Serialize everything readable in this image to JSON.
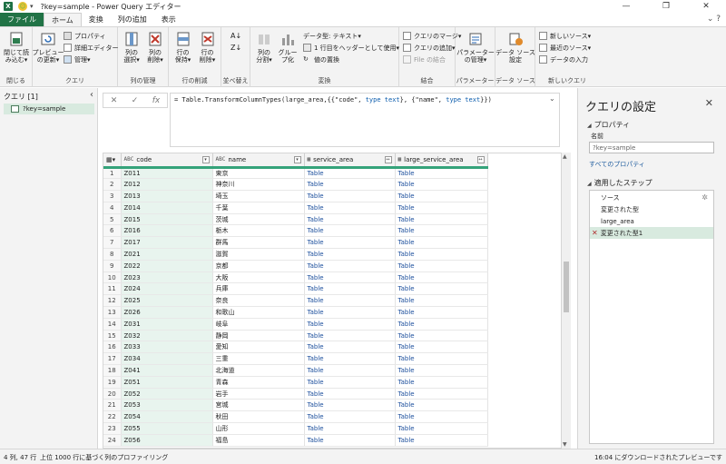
{
  "window": {
    "title": "?key=sample - Power Query エディター",
    "quick_access": "▾"
  },
  "menu_tabs": [
    "ファイル",
    "ホーム",
    "変換",
    "列の追加",
    "表示"
  ],
  "ribbon": {
    "groups": [
      {
        "label": "閉じる",
        "buttons": [
          "閉じて読\nみ込む▾"
        ]
      },
      {
        "label": "クエリ",
        "buttons": [
          "プレビュー\nの更新▾"
        ],
        "small": [
          "プロパティ",
          "詳細エディター",
          "管理▾"
        ]
      },
      {
        "label": "列の管理",
        "buttons": [
          "列の\n選択▾",
          "列の\n削除▾"
        ]
      },
      {
        "label": "行の削減",
        "buttons": [
          "行の\n保持▾",
          "行の\n削除▾"
        ]
      },
      {
        "label": "並べ替え"
      },
      {
        "label": "変換",
        "buttons": [
          "列の\n分割▾",
          "グルー\nプ化"
        ],
        "small": [
          "データ型: テキスト▾",
          "1 行目をヘッダーとして使用▾",
          "値の置換"
        ]
      },
      {
        "label": "結合",
        "small": [
          "クエリのマージ▾",
          "クエリの追加▾",
          "File の結合"
        ]
      },
      {
        "label": "パラメーター",
        "buttons": [
          "パラメーター\nの管理▾"
        ]
      },
      {
        "label": "データ ソース",
        "buttons": [
          "データ ソース\n設定"
        ]
      },
      {
        "label": "新しいクエリ",
        "small": [
          "新しいソース▾",
          "最近のソース▾",
          "データの入力"
        ]
      }
    ]
  },
  "queries_pane": {
    "header": "クエリ [1]",
    "items": [
      "?key=sample"
    ]
  },
  "formula": {
    "prefix": "= Table.TransformColumnTypes(large_area,{{\"code\", ",
    "t1": "type text",
    "mid": "}, {\"name\", ",
    "t2": "type text",
    "suffix": "}})"
  },
  "grid": {
    "columns": [
      {
        "name": "code",
        "type_tag": "ABC"
      },
      {
        "name": "name",
        "type_tag": "ABC"
      },
      {
        "name": "service_area",
        "type_tag": "▦"
      },
      {
        "name": "large_service_area",
        "type_tag": "▦"
      }
    ],
    "rows": [
      [
        "1",
        "Z011",
        "東京",
        "Table",
        "Table"
      ],
      [
        "2",
        "Z012",
        "神奈川",
        "Table",
        "Table"
      ],
      [
        "3",
        "Z013",
        "埼玉",
        "Table",
        "Table"
      ],
      [
        "4",
        "Z014",
        "千葉",
        "Table",
        "Table"
      ],
      [
        "5",
        "Z015",
        "茨城",
        "Table",
        "Table"
      ],
      [
        "6",
        "Z016",
        "栃木",
        "Table",
        "Table"
      ],
      [
        "7",
        "Z017",
        "群馬",
        "Table",
        "Table"
      ],
      [
        "8",
        "Z021",
        "滋賀",
        "Table",
        "Table"
      ],
      [
        "9",
        "Z022",
        "京都",
        "Table",
        "Table"
      ],
      [
        "10",
        "Z023",
        "大阪",
        "Table",
        "Table"
      ],
      [
        "11",
        "Z024",
        "兵庫",
        "Table",
        "Table"
      ],
      [
        "12",
        "Z025",
        "奈良",
        "Table",
        "Table"
      ],
      [
        "13",
        "Z026",
        "和歌山",
        "Table",
        "Table"
      ],
      [
        "14",
        "Z031",
        "岐阜",
        "Table",
        "Table"
      ],
      [
        "15",
        "Z032",
        "静岡",
        "Table",
        "Table"
      ],
      [
        "16",
        "Z033",
        "愛知",
        "Table",
        "Table"
      ],
      [
        "17",
        "Z034",
        "三重",
        "Table",
        "Table"
      ],
      [
        "18",
        "Z041",
        "北海道",
        "Table",
        "Table"
      ],
      [
        "19",
        "Z051",
        "青森",
        "Table",
        "Table"
      ],
      [
        "20",
        "Z052",
        "岩手",
        "Table",
        "Table"
      ],
      [
        "21",
        "Z053",
        "宮城",
        "Table",
        "Table"
      ],
      [
        "22",
        "Z054",
        "秋田",
        "Table",
        "Table"
      ],
      [
        "23",
        "Z055",
        "山形",
        "Table",
        "Table"
      ],
      [
        "24",
        "Z056",
        "福島",
        "Table",
        "Table"
      ]
    ]
  },
  "settings": {
    "title": "クエリの設定",
    "properties_header": "プロパティ",
    "name_label": "名前",
    "name_value": "?key=sample",
    "all_properties_link": "すべてのプロパティ",
    "steps_header": "適用したステップ",
    "steps": [
      "ソース",
      "変更された型",
      "large_area",
      "変更された型1"
    ],
    "selected_step": 3
  },
  "status": {
    "left": "4 列, 47 行",
    "middle": "上位 1000 行に基づく列のプロファイリング",
    "right": "16:04 にダウンロードされたプレビューです"
  },
  "colors": {
    "accent": "#217346",
    "selected": "#d8eadf",
    "link": "#1f5c9e"
  }
}
